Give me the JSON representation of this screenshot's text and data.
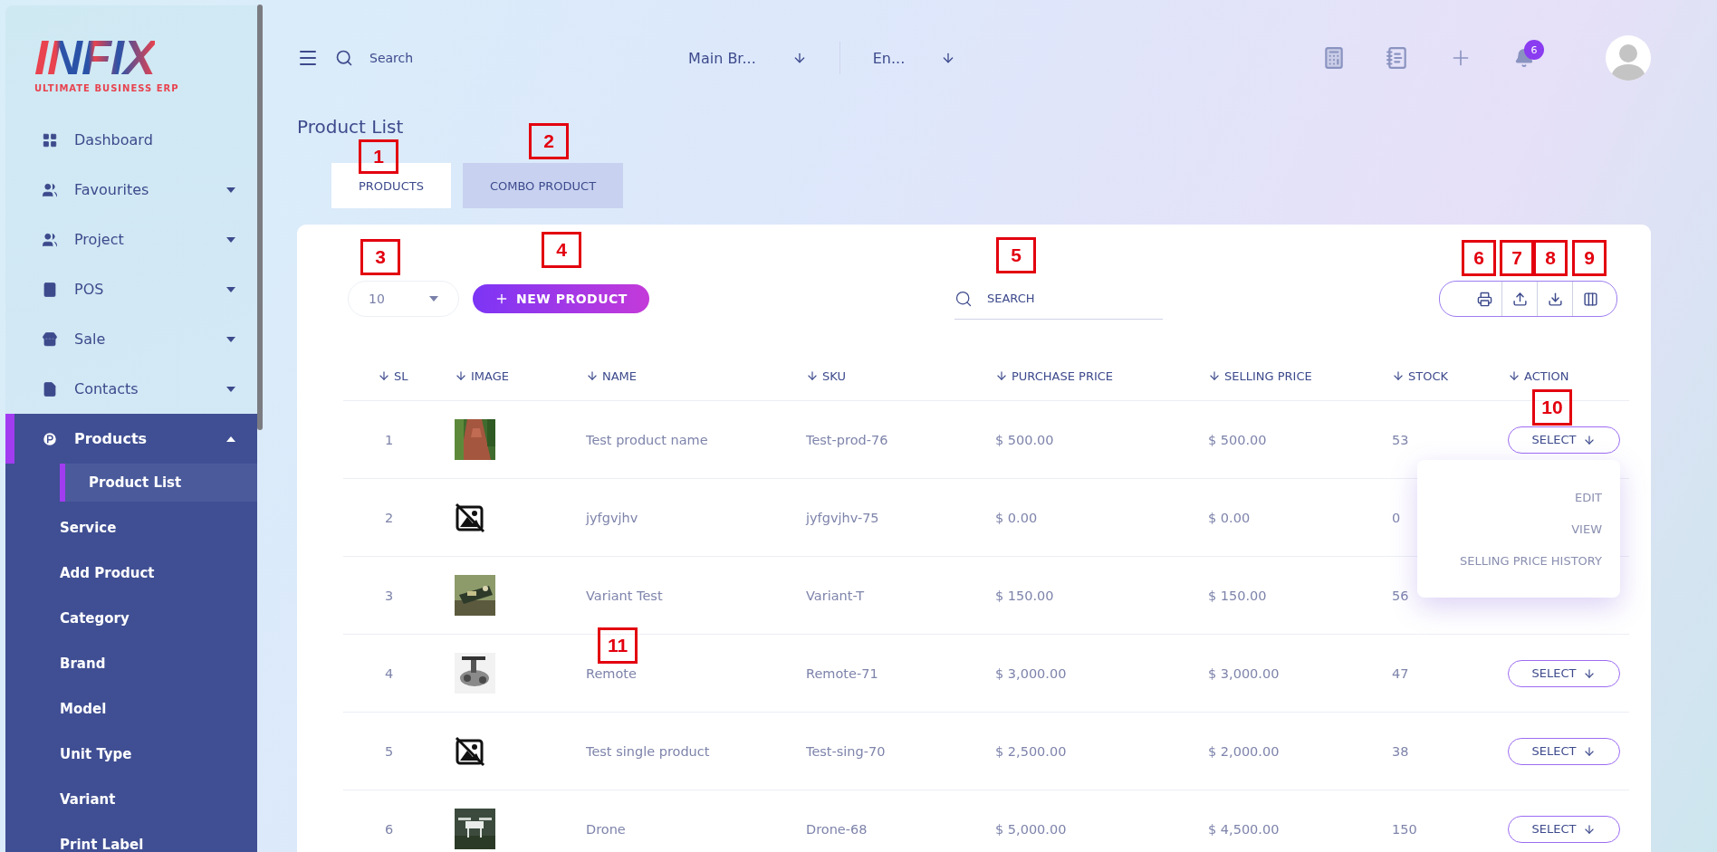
{
  "sidebar": {
    "logo": "INFIX",
    "tagline": "ULTIMATE BUSINESS ERP",
    "items": [
      {
        "label": "Dashboard"
      },
      {
        "label": "Favourites",
        "expanded": false
      },
      {
        "label": "Project",
        "expanded": false
      },
      {
        "label": "POS",
        "expanded": false
      },
      {
        "label": "Sale",
        "expanded": false
      },
      {
        "label": "Contacts",
        "expanded": false
      },
      {
        "label": "Products",
        "expanded": true,
        "children": [
          {
            "label": "Product List",
            "selected": true
          },
          {
            "label": "Service",
            "selected": false
          },
          {
            "label": "Add Product",
            "selected": false
          },
          {
            "label": "Category",
            "selected": false
          },
          {
            "label": "Brand",
            "selected": false
          },
          {
            "label": "Model",
            "selected": false
          },
          {
            "label": "Unit Type",
            "selected": false
          },
          {
            "label": "Variant",
            "selected": false
          },
          {
            "label": "Print Label",
            "selected": false
          }
        ]
      }
    ]
  },
  "header": {
    "search": {
      "placeholder": "Search"
    },
    "selectors": [
      {
        "value": "Main Br..."
      },
      {
        "value": "En..."
      }
    ],
    "notifications": "6"
  },
  "page": {
    "title": "Product List",
    "tabs": [
      {
        "label": "PRODUCTS",
        "selected": true
      },
      {
        "label": "COMBO PRODUCT",
        "selected": false
      }
    ],
    "page_size": "10",
    "new_button": "NEW PRODUCT",
    "search": {
      "placeholder": "SEARCH"
    },
    "table": {
      "columns": [
        "SL",
        "IMAGE",
        "NAME",
        "SKU",
        "PURCHASE PRICE",
        "SELLING PRICE",
        "STOCK",
        "ACTION"
      ],
      "rows": [
        {
          "sl": "1",
          "name": "Test product name",
          "sku": "Test-prod-76",
          "purchase": "$ 500.00",
          "selling": "$ 500.00",
          "stock": "53",
          "action": "SELECT"
        },
        {
          "sl": "2",
          "image": {
            "kind": "missing"
          },
          "name": "jyfgvjhv",
          "sku": "jyfgvjhv-75",
          "purchase": "$ 0.00",
          "selling": "$ 0.00",
          "stock": "0"
        },
        {
          "sl": "3",
          "name": "Variant Test",
          "sku": "Variant-T",
          "purchase": "$ 150.00",
          "selling": "$ 150.00",
          "stock": "56"
        },
        {
          "sl": "4",
          "name": "Remote",
          "sku": "Remote-71",
          "purchase": "$ 3,000.00",
          "selling": "$ 3,000.00",
          "stock": "47",
          "action": "SELECT"
        },
        {
          "sl": "5",
          "image": {
            "kind": "missing"
          },
          "name": "Test single product",
          "sku": "Test-sing-70",
          "purchase": "$ 2,500.00",
          "selling": "$ 2,000.00",
          "stock": "38",
          "action": "SELECT"
        },
        {
          "sl": "6",
          "name": "Drone",
          "sku": "Drone-68",
          "purchase": "$ 5,000.00",
          "selling": "$ 4,500.00",
          "stock": "150",
          "action": "SELECT"
        }
      ]
    },
    "action_menu": [
      "EDIT",
      "VIEW",
      "SELLING PRICE HISTORY"
    ]
  },
  "callouts": [
    {
      "label": "1"
    },
    {
      "label": "2"
    },
    {
      "label": "3"
    },
    {
      "label": "4"
    },
    {
      "label": "5"
    },
    {
      "label": "6"
    },
    {
      "label": "7"
    },
    {
      "label": "8"
    },
    {
      "label": "9"
    },
    {
      "label": "10"
    },
    {
      "label": "11"
    }
  ]
}
